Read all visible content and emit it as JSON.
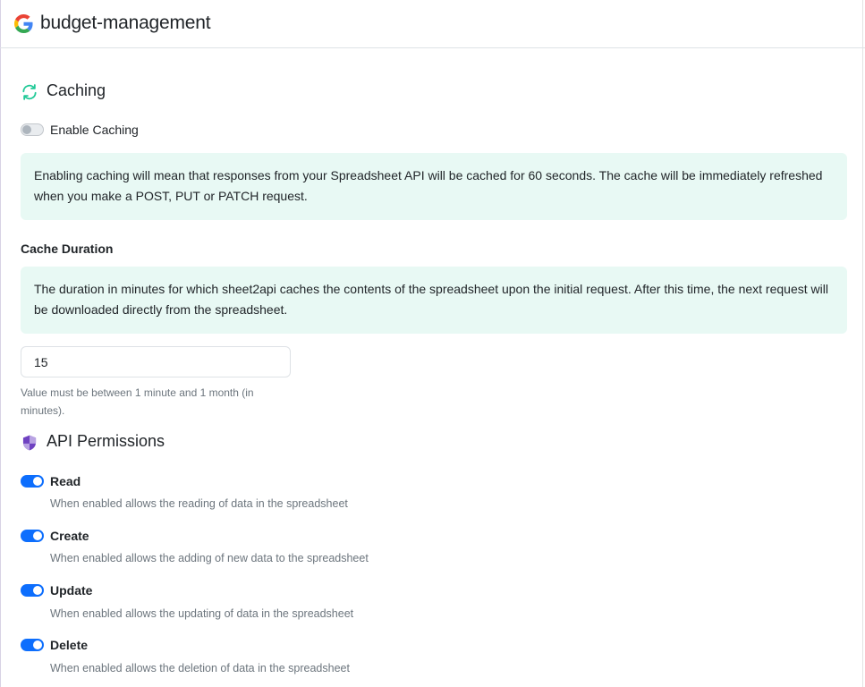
{
  "header": {
    "title": "budget-management",
    "logo_icon": "google-g-icon"
  },
  "caching": {
    "title": "Caching",
    "icon": "refresh-icon",
    "accent": "#20c997",
    "toggle_label": "Enable Caching",
    "enabled": false,
    "info": "Enabling caching will mean that responses from your Spreadsheet API will be cached for 60 seconds. The cache will be immediately refreshed when you make a POST, PUT or PATCH request."
  },
  "cache_duration": {
    "label": "Cache Duration",
    "info": "The duration in minutes for which sheet2api caches the contents of the spreadsheet upon the initial request. After this time, the next request will be downloaded directly from the spreadsheet.",
    "value": "15",
    "help": "Value must be between 1 minute and 1 month (in minutes)."
  },
  "permissions": {
    "title": "API Permissions",
    "icon": "shield-icon",
    "accent": "#6f42c1",
    "items": [
      {
        "name": "Read",
        "description": "When enabled allows the reading of data in the spreadsheet",
        "enabled": true
      },
      {
        "name": "Create",
        "description": "When enabled allows the adding of new data to the spreadsheet",
        "enabled": true
      },
      {
        "name": "Update",
        "description": "When enabled allows the updating of data in the spreadsheet",
        "enabled": true
      },
      {
        "name": "Delete",
        "description": "When enabled allows the deletion of data in the spreadsheet",
        "enabled": true
      }
    ]
  },
  "colors": {
    "toggle_on": "#0d6efd",
    "info_bg": "#e8f9f4"
  }
}
